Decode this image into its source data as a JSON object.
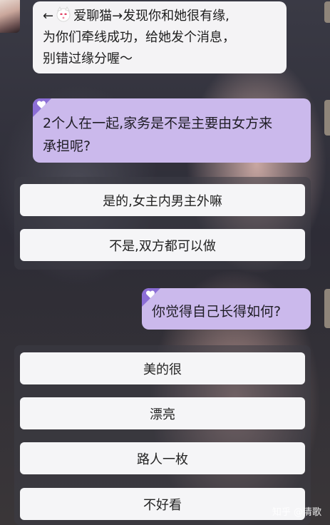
{
  "system_message": {
    "lines": [
      "←",
      "爱聊猫→发现你和她很有缘,",
      "为你们牵线成功，给她发个消息，",
      "别错过缘分喔～"
    ]
  },
  "questions": [
    {
      "lines": [
        "2个人在一起,家务是不是主要由女方来",
        "承担呢?"
      ],
      "options": [
        "是的,女主内男主外嘛",
        "不是,双方都可以做"
      ]
    },
    {
      "lines": [
        "你觉得自己长得如何?"
      ],
      "options": [
        "美的很",
        "漂亮",
        "路人一枚",
        "不好看"
      ]
    }
  ],
  "watermark": "知乎 @清歌",
  "icons": {
    "cat": "cat-emoji-icon",
    "heart": "heart-icon"
  },
  "colors": {
    "question_bubble": "#cbb9ec",
    "corner_accent": "#8c6ed6",
    "option_bg": "#f5f5f7"
  }
}
